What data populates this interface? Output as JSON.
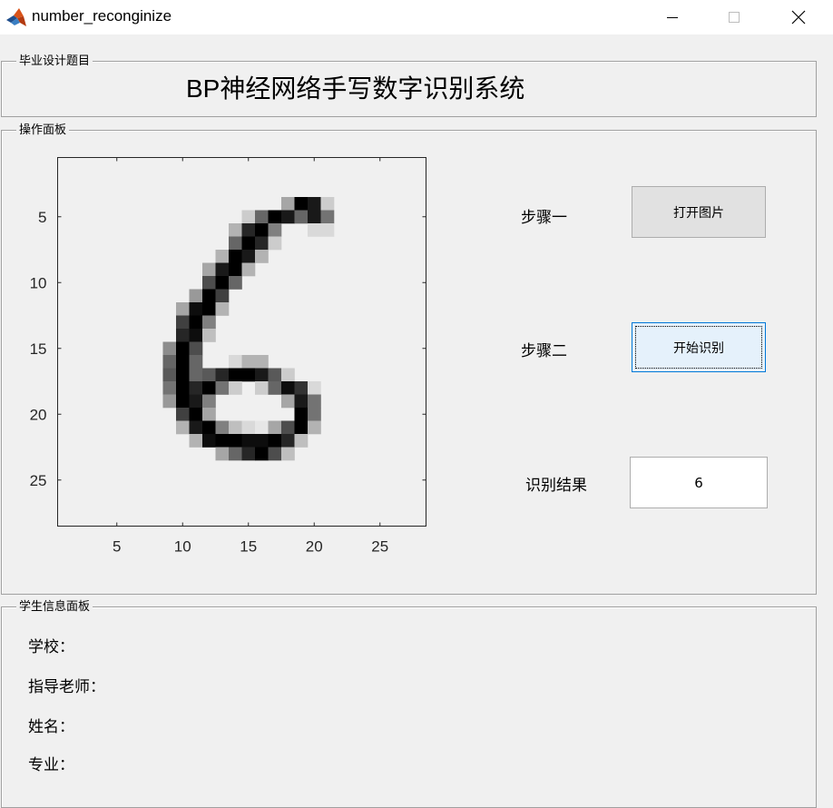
{
  "window": {
    "title": "number_reconginize",
    "minimize_symbol": "—",
    "maximize_symbol": "☐",
    "close_symbol": "✕",
    "icon": "matlab-icon"
  },
  "title_panel": {
    "label": "毕业设计题目",
    "heading": "BP神经网络手写数字识别系统"
  },
  "operation_panel": {
    "label": "操作面板",
    "step1_label": "步骤一",
    "step1_button": "打开图片",
    "step2_label": "步骤二",
    "step2_button": "开始识别",
    "result_label": "识别结果",
    "result_value": "6"
  },
  "student_panel": {
    "label": "学生信息面板",
    "school": "学校：",
    "advisor": "指导老师：",
    "name": "姓名：",
    "major": "专业："
  },
  "chart_data": {
    "type": "heatmap",
    "colormap": "gray-inverted",
    "x_range": [
      0.5,
      28.5
    ],
    "y_range": [
      0.5,
      28.5
    ],
    "y_direction": "reversed",
    "x_ticks": [
      5,
      10,
      15,
      20,
      25
    ],
    "y_ticks": [
      5,
      10,
      15,
      20,
      25
    ],
    "x_tick_labels": [
      "5",
      "10",
      "15",
      "20",
      "25"
    ],
    "y_tick_labels": [
      "5",
      "10",
      "15",
      "20",
      "25"
    ],
    "pixels": [
      [
        4,
        18,
        0.35
      ],
      [
        4,
        19,
        1
      ],
      [
        4,
        20,
        0.9
      ],
      [
        4,
        21,
        0.2
      ],
      [
        5,
        15,
        0.2
      ],
      [
        5,
        16,
        0.6
      ],
      [
        5,
        17,
        1
      ],
      [
        5,
        18,
        0.9
      ],
      [
        5,
        19,
        0.6
      ],
      [
        5,
        20,
        0.9
      ],
      [
        5,
        21,
        0.55
      ],
      [
        6,
        14,
        0.3
      ],
      [
        6,
        15,
        0.85
      ],
      [
        6,
        16,
        1
      ],
      [
        6,
        17,
        0.5
      ],
      [
        6,
        20,
        0.15
      ],
      [
        6,
        21,
        0.15
      ],
      [
        7,
        14,
        0.6
      ],
      [
        7,
        15,
        1
      ],
      [
        7,
        16,
        0.85
      ],
      [
        7,
        17,
        0.2
      ],
      [
        8,
        13,
        0.3
      ],
      [
        8,
        14,
        1
      ],
      [
        8,
        15,
        0.9
      ],
      [
        8,
        16,
        0.3
      ],
      [
        9,
        12,
        0.35
      ],
      [
        9,
        13,
        0.9
      ],
      [
        9,
        14,
        1
      ],
      [
        9,
        15,
        0.3
      ],
      [
        10,
        12,
        0.7
      ],
      [
        10,
        13,
        1
      ],
      [
        10,
        14,
        0.6
      ],
      [
        11,
        11,
        0.4
      ],
      [
        11,
        12,
        1
      ],
      [
        11,
        13,
        0.75
      ],
      [
        12,
        10,
        0.35
      ],
      [
        12,
        11,
        0.95
      ],
      [
        12,
        12,
        1
      ],
      [
        12,
        13,
        0.3
      ],
      [
        13,
        10,
        0.75
      ],
      [
        13,
        11,
        1
      ],
      [
        13,
        12,
        0.5
      ],
      [
        14,
        10,
        0.85
      ],
      [
        14,
        11,
        0.95
      ],
      [
        14,
        12,
        0.25
      ],
      [
        15,
        9,
        0.45
      ],
      [
        15,
        10,
        1
      ],
      [
        15,
        11,
        0.7
      ],
      [
        16,
        9,
        0.6
      ],
      [
        16,
        10,
        1
      ],
      [
        16,
        11,
        0.6
      ],
      [
        16,
        14,
        0.15
      ],
      [
        16,
        15,
        0.3
      ],
      [
        16,
        16,
        0.3
      ],
      [
        17,
        9,
        0.65
      ],
      [
        17,
        10,
        1
      ],
      [
        17,
        11,
        0.6
      ],
      [
        17,
        12,
        0.65
      ],
      [
        17,
        13,
        0.85
      ],
      [
        17,
        14,
        1
      ],
      [
        17,
        15,
        1
      ],
      [
        17,
        16,
        0.9
      ],
      [
        17,
        17,
        0.65
      ],
      [
        17,
        18,
        0.2
      ],
      [
        18,
        9,
        0.55
      ],
      [
        18,
        10,
        1
      ],
      [
        18,
        11,
        0.85
      ],
      [
        18,
        12,
        1
      ],
      [
        18,
        13,
        0.55
      ],
      [
        18,
        14,
        0.2
      ],
      [
        18,
        16,
        0.2
      ],
      [
        18,
        17,
        0.6
      ],
      [
        18,
        18,
        0.95
      ],
      [
        18,
        19,
        0.8
      ],
      [
        18,
        20,
        0.15
      ],
      [
        19,
        9,
        0.4
      ],
      [
        19,
        10,
        1
      ],
      [
        19,
        11,
        0.9
      ],
      [
        19,
        12,
        0.5
      ],
      [
        19,
        18,
        0.35
      ],
      [
        19,
        19,
        0.9
      ],
      [
        19,
        20,
        0.55
      ],
      [
        20,
        10,
        0.75
      ],
      [
        20,
        11,
        1
      ],
      [
        20,
        12,
        0.35
      ],
      [
        20,
        19,
        1
      ],
      [
        20,
        20,
        0.55
      ],
      [
        21,
        10,
        0.3
      ],
      [
        21,
        11,
        0.9
      ],
      [
        21,
        12,
        1
      ],
      [
        21,
        13,
        0.5
      ],
      [
        21,
        14,
        0.25
      ],
      [
        21,
        15,
        0.15
      ],
      [
        21,
        16,
        0.1
      ],
      [
        21,
        17,
        0.35
      ],
      [
        21,
        18,
        0.7
      ],
      [
        21,
        19,
        1
      ],
      [
        21,
        20,
        0.3
      ],
      [
        22,
        11,
        0.3
      ],
      [
        22,
        12,
        0.95
      ],
      [
        22,
        13,
        1
      ],
      [
        22,
        14,
        1
      ],
      [
        22,
        15,
        0.95
      ],
      [
        22,
        16,
        0.95
      ],
      [
        22,
        17,
        1
      ],
      [
        22,
        18,
        0.85
      ],
      [
        22,
        19,
        0.25
      ],
      [
        23,
        13,
        0.35
      ],
      [
        23,
        14,
        0.6
      ],
      [
        23,
        15,
        0.85
      ],
      [
        23,
        16,
        1
      ],
      [
        23,
        17,
        0.7
      ],
      [
        23,
        18,
        0.25
      ]
    ]
  }
}
